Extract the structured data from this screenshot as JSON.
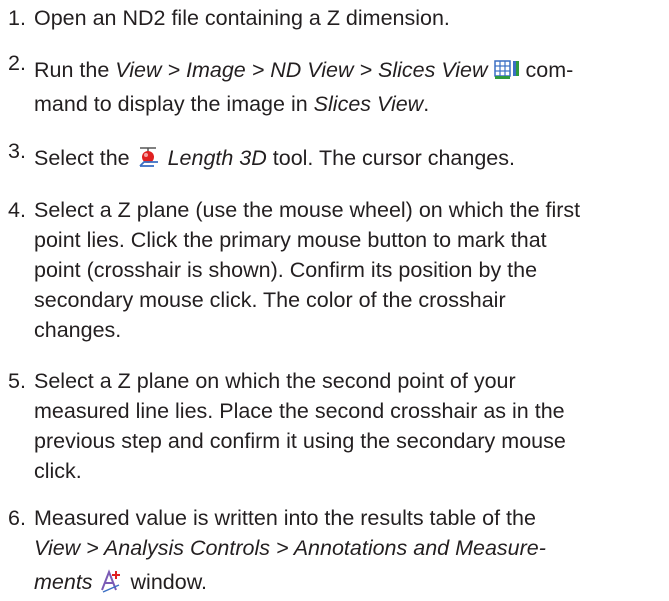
{
  "steps": [
    {
      "number": "1.",
      "text": "Open an ND2 file containing a Z dimension."
    },
    {
      "number": "2.",
      "pre": "Run the ",
      "command": "View > Image > ND View > Slices View",
      "post_line1": " com-",
      "line2_pre": "mand to display the image in ",
      "line2_em": "Slices View",
      "line2_post": ".",
      "icon": "slices-view-icon"
    },
    {
      "number": "3.",
      "pre": "Select the ",
      "tool": "Length 3D",
      "post": " tool. The cursor changes.",
      "icon": "length-3d-icon"
    },
    {
      "number": "4.",
      "lines": [
        "Select a Z plane (use the mouse wheel) on which the first",
        "point lies. Click the primary mouse button to mark that",
        "point (crosshair is shown). Confirm its position by the",
        "secondary mouse click. The color of the crosshair",
        "changes."
      ]
    },
    {
      "number": "5.",
      "lines": [
        "Select a Z plane on which the second point of your",
        "measured line lies. Place the second crosshair as in the",
        "previous step and confirm it using the secondary mouse",
        "click."
      ]
    },
    {
      "number": "6.",
      "line1": "Measured value is written into the results table of the",
      "line2_em": "View > Analysis Controls > Annotations and Measure-",
      "line3_em": "ments",
      "line3_post": " window.",
      "icon": "annotations-icon"
    }
  ],
  "colors": {
    "text": "#231f20",
    "icon_blue": "#3a6fc4",
    "icon_red": "#e02020",
    "icon_purple": "#7b5bb5"
  }
}
